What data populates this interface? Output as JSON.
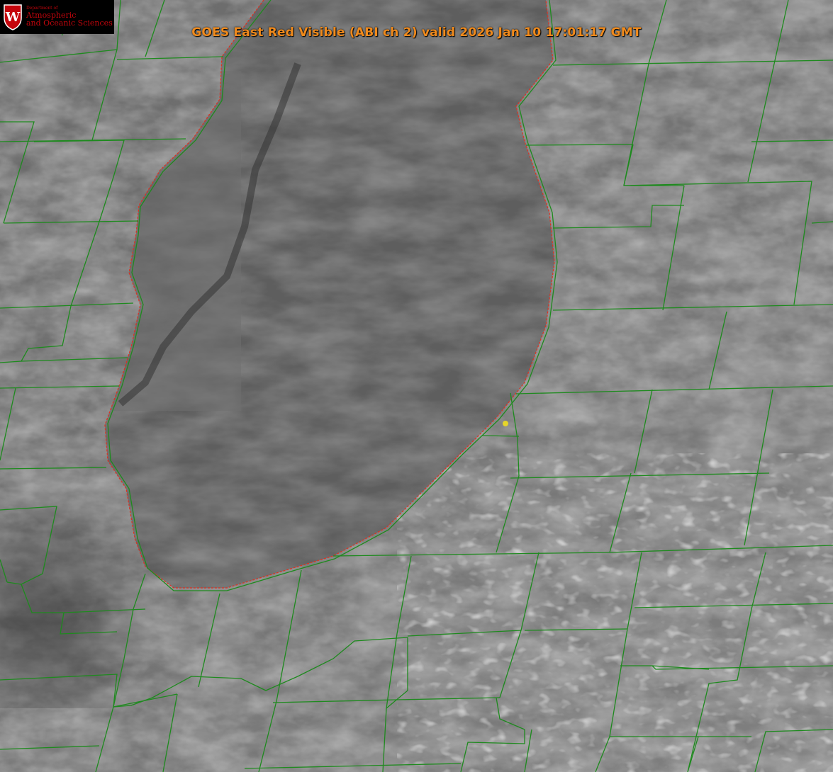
{
  "logo": {
    "department": "Department of",
    "line1": "Atmospheric",
    "line2": "and Oceanic Sciences",
    "letter": "W",
    "color": "#c5050c"
  },
  "title": "GOES East Red Visible (ABI ch 2) valid 2026 Jan 10 17:01:17 GMT",
  "colors": {
    "title": "#f08a1c",
    "boundaries": "#1e8a1e",
    "shoreline": "#e03020",
    "marker": "#e6d62a",
    "cloud_base": "#7a7a7a",
    "lake_base": "#5c5c5c"
  },
  "marker": {
    "label": "yellow-dot-marker"
  }
}
